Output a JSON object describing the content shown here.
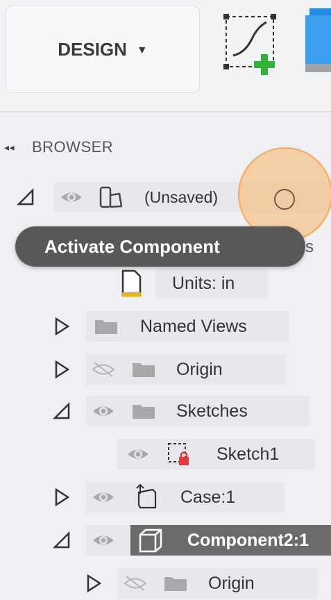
{
  "toolbar": {
    "workspace_label": "DESIGN",
    "caret": "▼"
  },
  "browser": {
    "title": "BROWSER",
    "root_label": "(Unsaved)",
    "tooltip": "Activate Component",
    "behind_text": "s",
    "items": {
      "units": "Units: in",
      "named_views": "Named Views",
      "origin": "Origin",
      "sketches": "Sketches",
      "sketch1": "Sketch1",
      "case": "Case:1",
      "component2": "Component2:1",
      "origin2": "Origin"
    }
  },
  "colors": {
    "accent_orange": "#f5a046",
    "selected_row": "#6b6b6b",
    "green_plus": "#2fb33a",
    "red_lock": "#e0393c"
  }
}
